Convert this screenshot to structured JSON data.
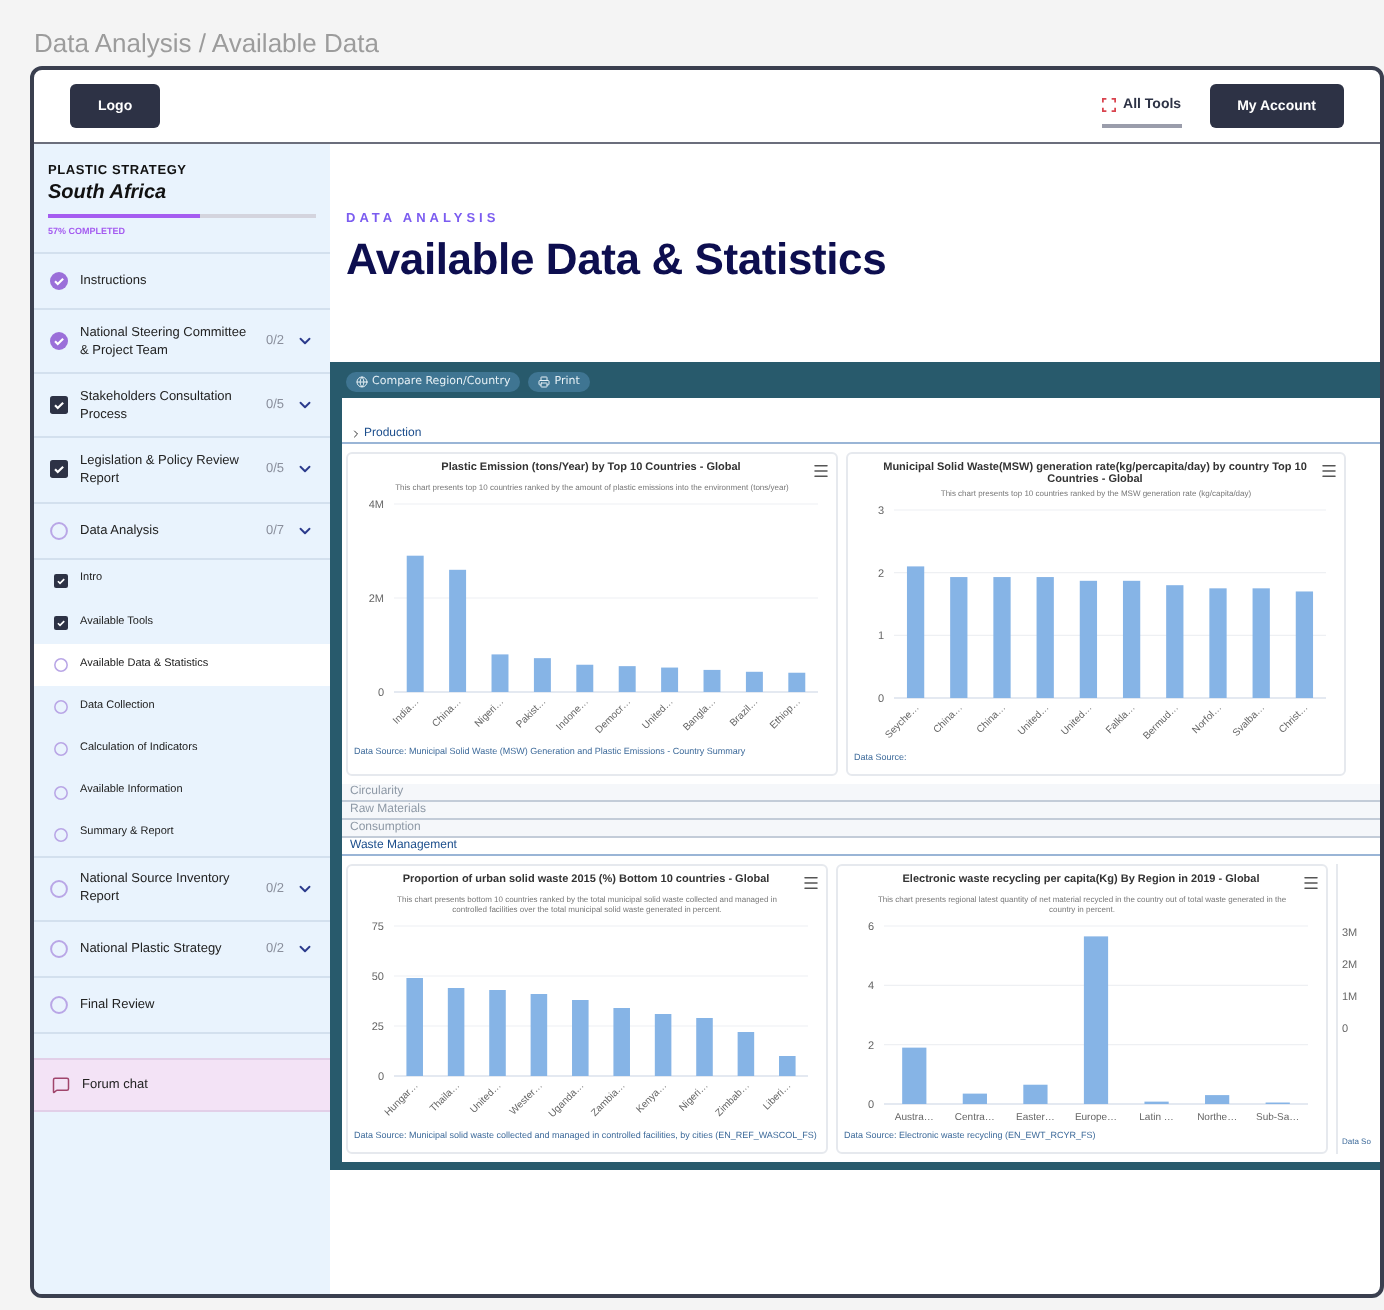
{
  "breadcrumb": "Data Analysis / Available Data",
  "header": {
    "logo_button": "Logo",
    "nav_link": {
      "label": "All Tools",
      "selected": true
    },
    "account_button": "My Account"
  },
  "sidebar": {
    "eyebrow": "PLASTIC STRATEGY",
    "country": "South Africa",
    "progress": {
      "level": 0.57,
      "label": "57% COMPLETED"
    },
    "steps": [
      {
        "label": "Instructions",
        "kind": "done"
      },
      {
        "label": "National Steering Committee & Project Team",
        "kind": "done",
        "count": "0/2"
      },
      {
        "label": "Stakeholders Consultation Process",
        "kind": "checked",
        "count": "0/5"
      },
      {
        "label": "Legislation & Policy Review Report",
        "kind": "checked",
        "count": "0/5"
      },
      {
        "label": "Data Analysis",
        "kind": "open",
        "count": "0/7",
        "children": [
          {
            "label": "Intro",
            "kind": "checked",
            "selected": false
          },
          {
            "label": "Available Tools",
            "kind": "checked",
            "selected": false
          },
          {
            "label": "Available Data & Statistics",
            "kind": "open",
            "selected": true
          },
          {
            "label": "Data Collection",
            "kind": "open",
            "selected": false
          },
          {
            "label": "Calculation of Indicators",
            "kind": "open",
            "selected": false
          },
          {
            "label": "Available Information",
            "kind": "open",
            "selected": false
          },
          {
            "label": "Summary & Report",
            "kind": "open",
            "selected": false
          }
        ]
      },
      {
        "label": "National Source Inventory Report",
        "kind": "open",
        "count": "0/2"
      },
      {
        "label": "National Plastic Strategy",
        "kind": "open",
        "count": "0/2"
      },
      {
        "label": "Final Review",
        "kind": "open"
      }
    ],
    "forum": "Forum chat"
  },
  "page": {
    "eyebrow": "DATA ANALYSIS",
    "title": "Available Data & Statistics"
  },
  "dashboard": {
    "toolbar": [
      {
        "label": "Compare Region/Country",
        "kind": "compare"
      },
      {
        "label": "Print",
        "kind": "print"
      }
    ],
    "sections": [
      {
        "title": "Production",
        "expanded": true,
        "charts": [
          {
            "title": "Plastic Emission (tons/Year) by Top 10 Countries - Global",
            "subtitle": "This chart presents top 10 countries ranked by the amount of plastic emissions into the environment (tons/year)",
            "source": "Data Source: Municipal Solid Waste (MSW) Generation and Plastic Emissions - Country Summary",
            "chart_data": {
              "type": "bar",
              "categories": [
                "India…",
                "China…",
                "Nigeri…",
                "Pakist…",
                "Indone…",
                "Democr…",
                "United…",
                "Bangla…",
                "Brazil…",
                "Ethiop…"
              ],
              "series": [
                {
                  "color": "#86b4e6",
                  "values": [
                    2900000,
                    2600000,
                    800000,
                    720000,
                    580000,
                    550000,
                    520000,
                    470000,
                    430000,
                    410000
                  ]
                }
              ],
              "ylim": [
                0,
                4000000
              ],
              "yticks": [
                {
                  "value": 0,
                  "label": "0"
                },
                {
                  "value": 2000000,
                  "label": "2M"
                },
                {
                  "value": 4000000,
                  "label": "4M"
                }
              ]
            }
          },
          {
            "title": "Municipal Solid Waste(MSW) generation rate(kg/percapita/day) by country Top 10 Countries - Global",
            "subtitle": "This chart presents top 10 countries ranked by the MSW generation rate (kg/capita/day)",
            "source": "Data Source:",
            "chart_data": {
              "type": "bar",
              "categories": [
                "Seyche…",
                "China…",
                "China…",
                "United…",
                "United…",
                "Falkla…",
                "Bermud…",
                "Norfol…",
                "Svalba…",
                "Christ…"
              ],
              "series": [
                {
                  "color": "#86b4e6",
                  "values": [
                    2.1,
                    1.93,
                    1.93,
                    1.93,
                    1.87,
                    1.87,
                    1.8,
                    1.75,
                    1.75,
                    1.7
                  ]
                }
              ],
              "ylim": [
                0,
                3
              ],
              "yticks": [
                0,
                1,
                2,
                3
              ]
            }
          }
        ]
      },
      {
        "title": "Circularity",
        "expanded": false
      },
      {
        "title": "Raw Materials",
        "expanded": false
      },
      {
        "title": "Consumption",
        "expanded": false
      },
      {
        "title": "Waste Management",
        "expanded": true,
        "charts": [
          {
            "title": "Proportion of urban solid waste 2015 (%) Bottom 10 countries - Global",
            "subtitle": "This chart presents bottom 10 countries ranked by the total municipal solid waste collected and managed in controlled facilities over the total municipal solid waste generated in percent.",
            "source": "Data Source: Municipal solid waste collected and managed in controlled facilities, by cities (EN_REF_WASCOL_FS)",
            "chart_data": {
              "type": "bar",
              "categories": [
                "Hungar…",
                "Thaila…",
                "United…",
                "Wester…",
                "Uganda…",
                "Zambia…",
                "Kenya…",
                "Nigeri…",
                "Zimbab…",
                "Liberi…"
              ],
              "series": [
                {
                  "color": "#86b4e6",
                  "values": [
                    49,
                    44,
                    43,
                    41,
                    38,
                    34,
                    31,
                    29,
                    22,
                    10
                  ]
                }
              ],
              "ylim": [
                0,
                75
              ],
              "yticks": [
                0,
                25,
                50,
                75
              ]
            }
          },
          {
            "title": "Electronic waste recycling per capita(Kg) By Region in 2019 - Global",
            "subtitle": "This chart presents regional latest quantity of net material recycled in the country out of total waste generated in the country in percent.",
            "source": "Data Source: Electronic waste recycling (EN_EWT_RCYR_FS)",
            "chart_data": {
              "type": "bar",
              "categories": [
                "Austra…",
                "Centra…",
                "Easter…",
                "Europe…",
                "Latin …",
                "Northe…",
                "Sub-Sa…"
              ],
              "series": [
                {
                  "color": "#86b4e6",
                  "values": [
                    1.9,
                    0.35,
                    0.65,
                    5.65,
                    0.08,
                    0.3,
                    0.05
                  ]
                }
              ],
              "ylim": [
                0,
                6
              ],
              "yticks": [
                0,
                2,
                4,
                6
              ]
            }
          }
        ],
        "partial_card": {
          "axis_labels": [
            "3M",
            "2M",
            "1M",
            "0"
          ],
          "source": "Data So"
        }
      }
    ]
  }
}
